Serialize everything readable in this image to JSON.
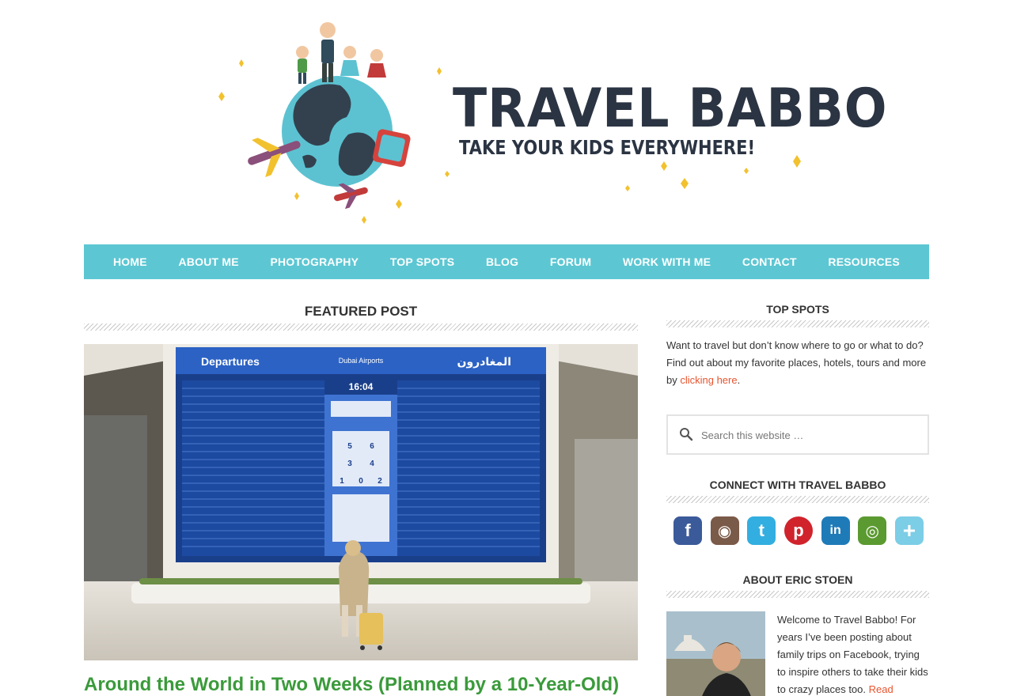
{
  "header": {
    "site_title": "TRAVEL BABBO",
    "tagline": "TAKE YOUR KIDS EVERYWHERE!"
  },
  "nav": {
    "items": [
      {
        "label": "HOME"
      },
      {
        "label": "ABOUT ME"
      },
      {
        "label": "PHOTOGRAPHY"
      },
      {
        "label": "TOP SPOTS"
      },
      {
        "label": "BLOG"
      },
      {
        "label": "FORUM"
      },
      {
        "label": "WORK WITH ME"
      },
      {
        "label": "CONTACT"
      },
      {
        "label": "RESOURCES"
      }
    ]
  },
  "main": {
    "featured_heading": "FEATURED POST",
    "image": {
      "left_sign": "Departures",
      "center_sign": "Dubai Airports",
      "right_sign": "المغادرون",
      "clock": "16:04",
      "gates": [
        "5",
        "6",
        "3",
        "4",
        "1",
        "0",
        "2"
      ]
    },
    "post_title": "Around the World in Two Weeks (Planned by a 10-Year-Old)"
  },
  "sidebar": {
    "top_spots": {
      "heading": "TOP SPOTS",
      "text": "Want to travel but don’t know where to go or what to do? Find out about my favorite places, hotels, tours and more by ",
      "link": "clicking here",
      "after": "."
    },
    "search": {
      "placeholder": "Search this website …"
    },
    "connect": {
      "heading": "CONNECT WITH TRAVEL BABBO",
      "icons": [
        {
          "name": "facebook-icon",
          "glyph": "f",
          "color": "#3b5a9a"
        },
        {
          "name": "instagram-icon",
          "glyph": "◉",
          "color": "#7a5a48"
        },
        {
          "name": "twitter-icon",
          "glyph": "t",
          "color": "#33aee0"
        },
        {
          "name": "pinterest-icon",
          "glyph": "p",
          "color": "#d0232c"
        },
        {
          "name": "linkedin-icon",
          "glyph": "in",
          "color": "#1f7bb8"
        },
        {
          "name": "tripadvisor-icon",
          "glyph": "◎",
          "color": "#5b9a30"
        },
        {
          "name": "more-icon",
          "glyph": "+",
          "color": "#7ccde6"
        }
      ]
    },
    "about": {
      "heading": "ABOUT ERIC STOEN",
      "text": "Welcome to Travel Babbo! For years I’ve been posting about family trips on Facebook, trying to inspire others to take their kids to crazy places too. ",
      "link": "Read"
    }
  }
}
